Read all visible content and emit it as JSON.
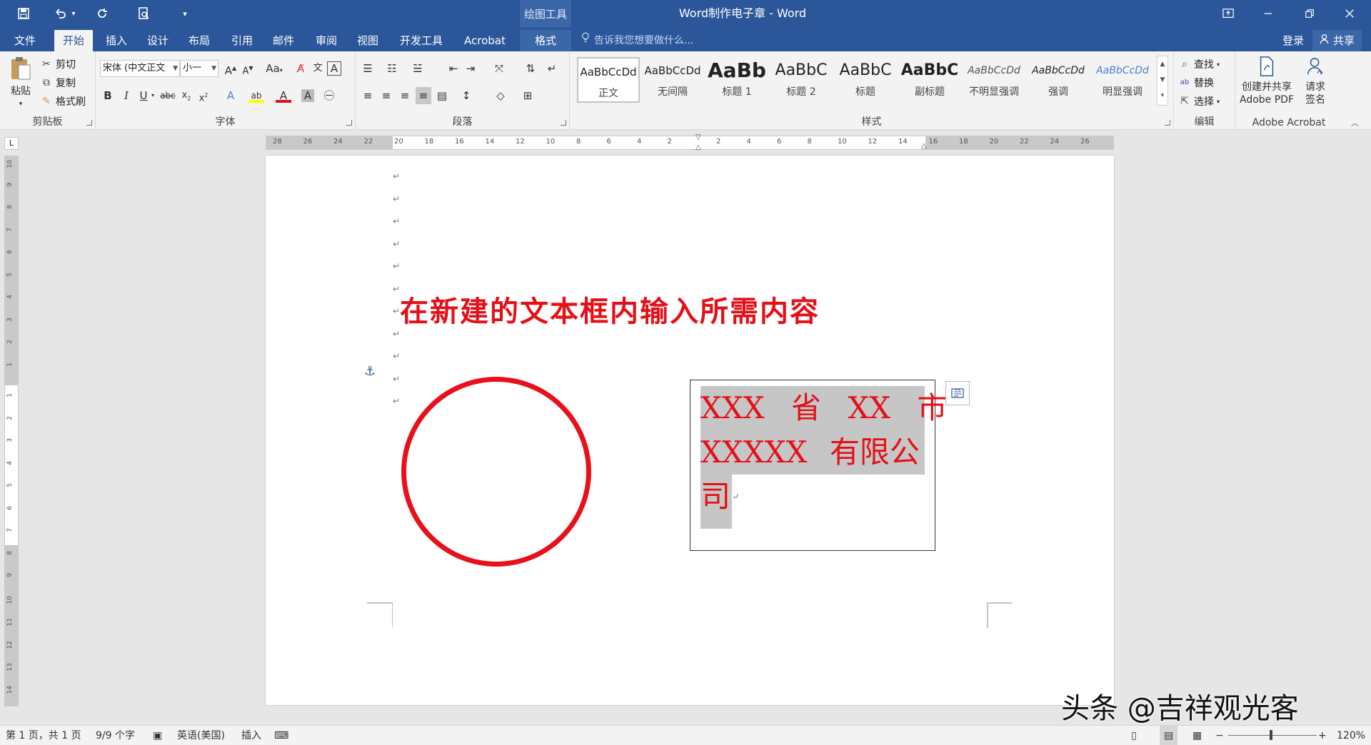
{
  "titlebar": {
    "title": "Word制作电子章 - Word",
    "context_label": "绘图工具",
    "window_buttons": [
      "ribbon-display-options",
      "minimize",
      "restore",
      "close"
    ]
  },
  "tabs": {
    "items": [
      "文件",
      "开始",
      "插入",
      "设计",
      "布局",
      "引用",
      "邮件",
      "审阅",
      "视图",
      "开发工具",
      "Acrobat",
      "格式"
    ],
    "active": "开始",
    "tell_me": "告诉我您想要做什么...",
    "login": "登录",
    "share": "共享"
  },
  "clipboard": {
    "paste": "粘贴",
    "cut": "剪切",
    "copy": "复制",
    "format_painter": "格式刷",
    "label": "剪贴板"
  },
  "font": {
    "font_name": "宋体 (中文正文",
    "font_size": "小一",
    "case_button": "Aa",
    "label": "字体"
  },
  "paragraph": {
    "label": "段落"
  },
  "styles": {
    "label": "样式",
    "items": [
      {
        "sample": "AaBbCcDd",
        "name": "正文"
      },
      {
        "sample": "AaBbCcDd",
        "name": "无间隔"
      },
      {
        "sample": "AaBb",
        "name": "标题 1"
      },
      {
        "sample": "AaBbC",
        "name": "标题 2"
      },
      {
        "sample": "AaBbC",
        "name": "标题"
      },
      {
        "sample": "AaBbC",
        "name": "副标题"
      },
      {
        "sample": "AaBbCcDd",
        "name": "不明显强调"
      },
      {
        "sample": "AaBbCcDd",
        "name": "强调"
      },
      {
        "sample": "AaBbCcDd",
        "name": "明显强调"
      }
    ]
  },
  "editing": {
    "find": "查找",
    "replace": "替换",
    "select": "选择",
    "label": "编辑"
  },
  "acrobat": {
    "create_share": "创建并共享",
    "create_share_2": "Adobe PDF",
    "request": "请求",
    "request_2": "签名",
    "label": "Adobe Acrobat"
  },
  "ruler": {
    "horizontal_ticks": [
      "28",
      "26",
      "24",
      "22",
      "20",
      "18",
      "16",
      "14",
      "12",
      "10",
      "8",
      "6",
      "4",
      "2",
      "2",
      "4",
      "6",
      "8",
      "10",
      "12",
      "14",
      "16",
      "18",
      "20",
      "22",
      "24",
      "26"
    ],
    "vertical_ticks_top": [
      "10",
      "9",
      "8",
      "7",
      "6",
      "5",
      "4",
      "3",
      "2",
      "1"
    ],
    "vertical_ticks_bottom": [
      "1",
      "2",
      "3",
      "4",
      "5",
      "6",
      "7",
      "8",
      "9",
      "10",
      "11",
      "12",
      "13",
      "14"
    ],
    "corner": "L"
  },
  "document": {
    "heading": "在新建的文本框内输入所需内容",
    "textbox_line1": "XXX 省 XX 市",
    "textbox_line2": "XXXXX 有限公",
    "textbox_line3": "司",
    "paragraph_mark": "↵",
    "seal_color": "#e8101a"
  },
  "watermark": "头条 @吉祥观光客",
  "statusbar": {
    "page": "第 1 页，共 1 页",
    "words": "9/9 个字",
    "language": "英语(美国)",
    "mode": "插入",
    "zoom": "120%",
    "zoom_value_percent": 120
  },
  "colors": {
    "brand": "#2b579a",
    "accent_red": "#e41018",
    "selection": "#c6c6c6"
  }
}
